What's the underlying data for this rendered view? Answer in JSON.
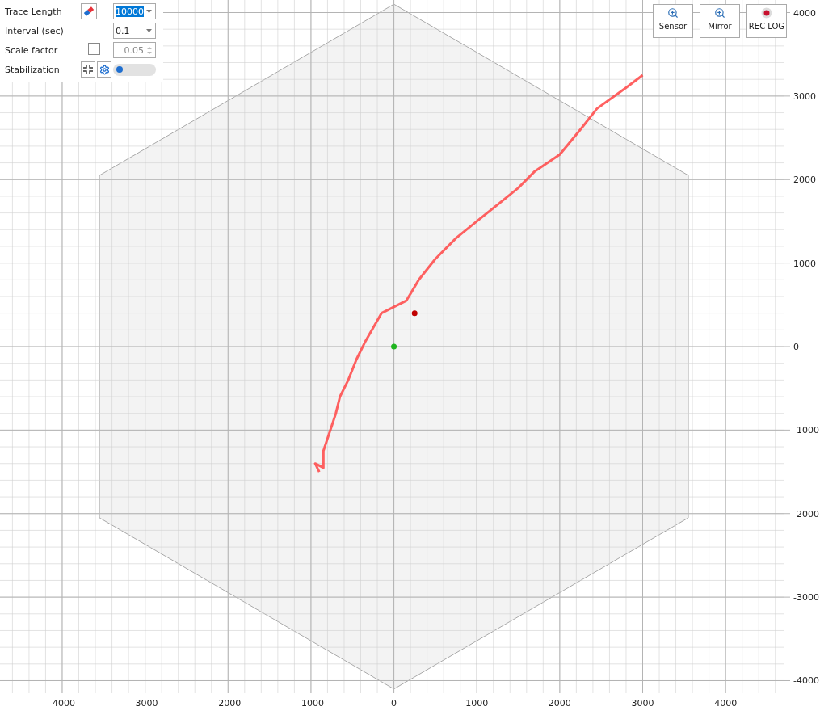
{
  "controls": {
    "trace_length": {
      "label": "Trace Length",
      "value": "10000",
      "value_highlighted": true
    },
    "interval": {
      "label": "Interval (sec)",
      "value": "0.1"
    },
    "scale_factor": {
      "label": "Scale factor",
      "checked": false,
      "value": "0.05",
      "disabled": true
    },
    "stabilization": {
      "label": "Stabilization",
      "on": false
    }
  },
  "buttons": [
    {
      "kind": "zoom",
      "label": "Sensor"
    },
    {
      "kind": "zoom",
      "label": "Mirror"
    },
    {
      "kind": "record",
      "label": "REC LOG"
    }
  ],
  "plot": {
    "chart_data": {
      "type": "line",
      "grid": true,
      "x": [
        3000,
        2800,
        2450,
        2250,
        2000,
        1700,
        1500,
        1250,
        1000,
        750,
        500,
        300,
        150,
        -150,
        -350,
        -450,
        -550,
        -650,
        -700,
        -750,
        -800,
        -850,
        -850,
        -950,
        -900,
        250,
        0
      ],
      "series": [
        {
          "color": "#ff4545",
          "values": [
            3250,
            3100,
            2850,
            2600,
            2300,
            2100,
            1900,
            1700,
            1500,
            1300,
            1050,
            800,
            550,
            400,
            50,
            -150,
            -400,
            -600,
            -800,
            -950,
            -1100,
            -1250,
            -1450,
            -1400,
            -1500,
            null,
            null
          ]
        },
        {
          "color": "#c00000",
          "marker": true,
          "values": [
            null,
            null,
            null,
            null,
            null,
            null,
            null,
            null,
            null,
            null,
            null,
            null,
            null,
            null,
            null,
            null,
            null,
            null,
            null,
            null,
            null,
            null,
            null,
            null,
            null,
            400,
            null
          ]
        },
        {
          "color": "#1fb51f",
          "marker": true,
          "values": [
            null,
            null,
            null,
            null,
            null,
            null,
            null,
            null,
            null,
            null,
            null,
            null,
            null,
            null,
            null,
            null,
            null,
            null,
            null,
            null,
            null,
            null,
            null,
            null,
            null,
            null,
            0
          ]
        }
      ],
      "xlim": [
        -4750,
        4700
      ],
      "ylim": [
        -4150,
        4150
      ],
      "xticks": [
        -4000,
        -3000,
        -2000,
        -1000,
        0,
        1000,
        2000,
        3000,
        4000
      ],
      "yticks": [
        -4000,
        -3000,
        -2000,
        -1000,
        0,
        1000,
        2000,
        3000,
        4000
      ]
    }
  }
}
